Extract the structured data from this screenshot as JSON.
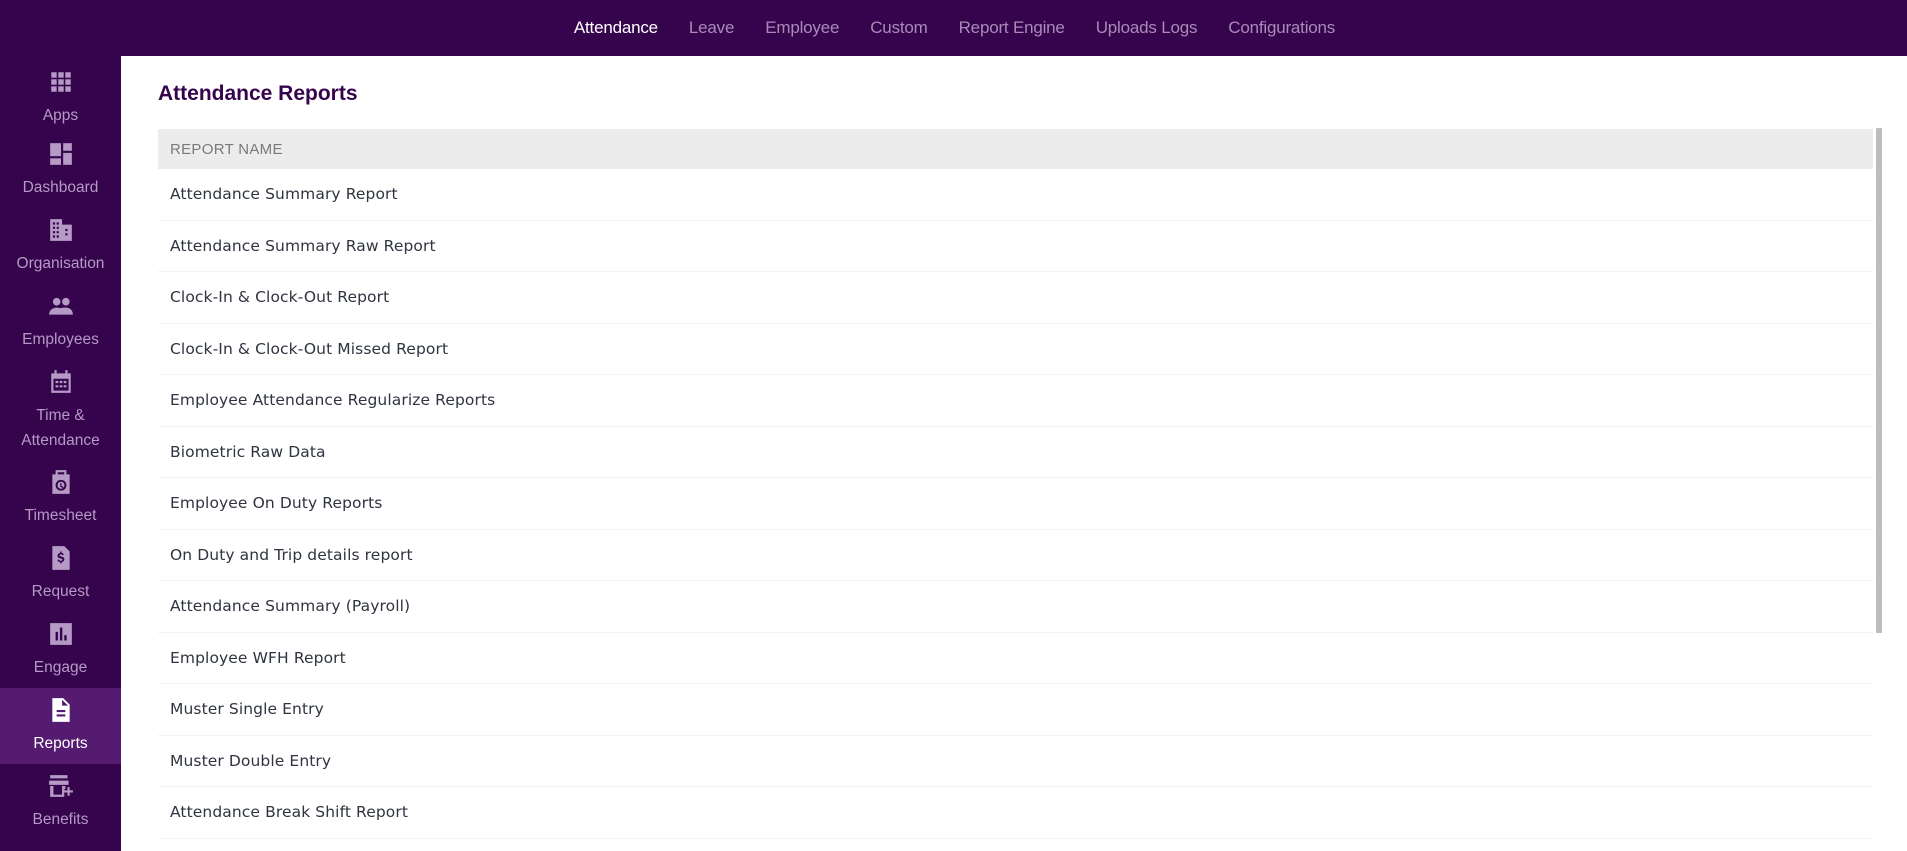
{
  "topnav": {
    "tabs": [
      {
        "label": "Attendance",
        "active": true
      },
      {
        "label": "Leave",
        "active": false
      },
      {
        "label": "Employee",
        "active": false
      },
      {
        "label": "Custom",
        "active": false
      },
      {
        "label": "Report Engine",
        "active": false
      },
      {
        "label": "Uploads Logs",
        "active": false
      },
      {
        "label": "Configurations",
        "active": false
      }
    ]
  },
  "sidebar": {
    "items": [
      {
        "label": "Apps",
        "icon": "apps-grid-icon"
      },
      {
        "label": "Dashboard",
        "icon": "dashboard-icon"
      },
      {
        "label": "Organisation",
        "icon": "building-icon"
      },
      {
        "label": "Employees",
        "icon": "people-icon"
      },
      {
        "label": "Time & Attendance",
        "icon": "calendar-icon"
      },
      {
        "label": "Timesheet",
        "icon": "timesheet-clock-icon"
      },
      {
        "label": "Request",
        "icon": "dollar-document-icon"
      },
      {
        "label": "Engage",
        "icon": "bar-chart-icon"
      },
      {
        "label": "Reports",
        "icon": "report-document-icon",
        "active": true
      },
      {
        "label": "Benefits",
        "icon": "store-plus-icon"
      }
    ]
  },
  "main": {
    "title": "Attendance Reports",
    "table": {
      "header": "REPORT NAME",
      "rows": [
        "Attendance Summary Report",
        "Attendance Summary Raw Report",
        "Clock-In & Clock-Out Report",
        "Clock-In & Clock-Out Missed Report",
        "Employee Attendance Regularize Reports",
        "Biometric Raw Data",
        "Employee On Duty Reports",
        "On Duty and Trip details report",
        "Attendance Summary (Payroll)",
        "Employee WFH Report",
        "Muster Single Entry",
        "Muster Double Entry",
        "Attendance Break Shift Report"
      ]
    }
  },
  "colors": {
    "brand": "#36044d",
    "active_sidebar": "#541b70",
    "title": "#36044d",
    "table_header_bg": "#ececec"
  }
}
